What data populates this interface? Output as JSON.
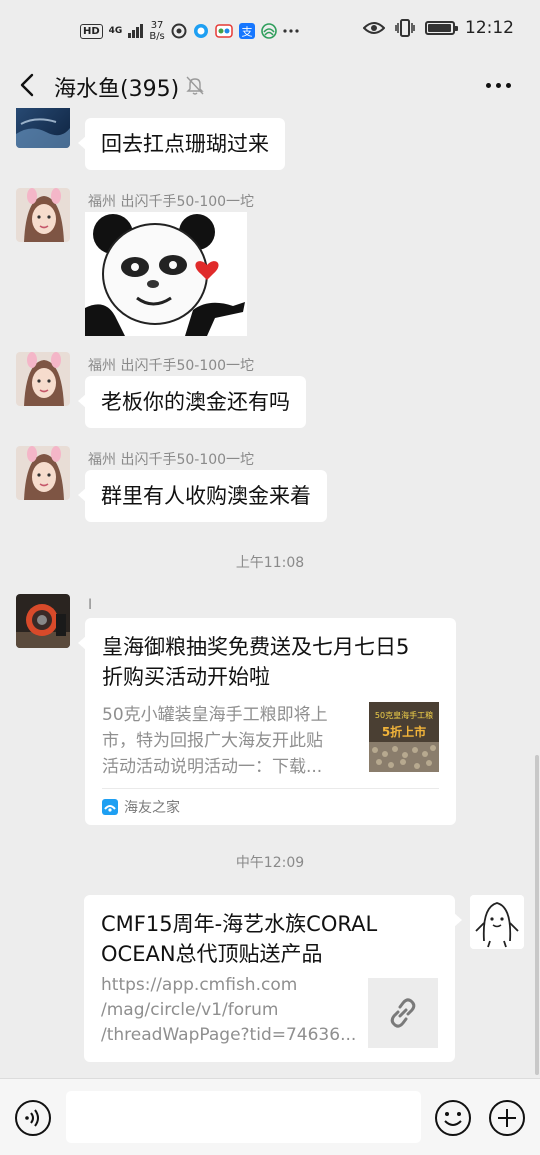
{
  "status_bar": {
    "hd": "HD",
    "network_type": "4G",
    "net_speed_value": "37",
    "net_speed_unit": "B/s",
    "time": "12:12",
    "battery_level": 0.95,
    "icons": [
      "hd-icon",
      "signal-icon",
      "wechat-dot-icon",
      "qq-browser-icon",
      "maps-icon",
      "alipay-icon",
      "china-mobile-icon",
      "more-dots-icon",
      "eye-icon",
      "vibrate-icon",
      "battery-icon"
    ]
  },
  "header": {
    "title": "海水鱼(395)",
    "icons": [
      "back-arrow-icon",
      "mute-bell-icon",
      "more-icon"
    ]
  },
  "messages": {
    "m0": {
      "text": "回去扛点珊瑚过来"
    },
    "m1": {
      "sender": "福州 出闪千手50-100一坨",
      "sticker": "panda-meme-heart-sticker"
    },
    "m2": {
      "sender": "福州 出闪千手50-100一坨",
      "text": "老板你的澳金还有吗"
    },
    "m3": {
      "sender": "福州 出闪千手50-100一坨",
      "text": "群里有人收购澳金来着"
    },
    "time1": "上午11:08",
    "m4": {
      "sender": "I",
      "title_line1": "皇海御粮抽奖免费送及七月七日5",
      "title_line2": "折购买活动开始啦",
      "desc_line1": "50克小罐装皇海手工粮即将上",
      "desc_line2": "市，特为回报广大海友开此贴",
      "desc_line3": "活动活动说明活动一：下载...",
      "thumb_text1": "50克皇海手工粮",
      "thumb_text2": "5折上市",
      "source": "海友之家"
    },
    "time2": "中午12:09",
    "m5": {
      "title_line1": "CMF15周年-海艺水族CORAL",
      "title_line2": "OCEAN总代顶贴送产品",
      "url_line1": "https://app.cmfish.com",
      "url_line2": "/mag/circle/v1/forum",
      "url_line3": "/threadWapPage?tid=74636..."
    }
  },
  "input_bar": {
    "placeholder": "",
    "icons": [
      "voice-icon",
      "emoji-icon",
      "plus-icon"
    ]
  },
  "colors": {
    "background": "#ededed",
    "bubble": "#ffffff",
    "meta_text": "#8a8a8a",
    "heart": "#e02b2b"
  }
}
